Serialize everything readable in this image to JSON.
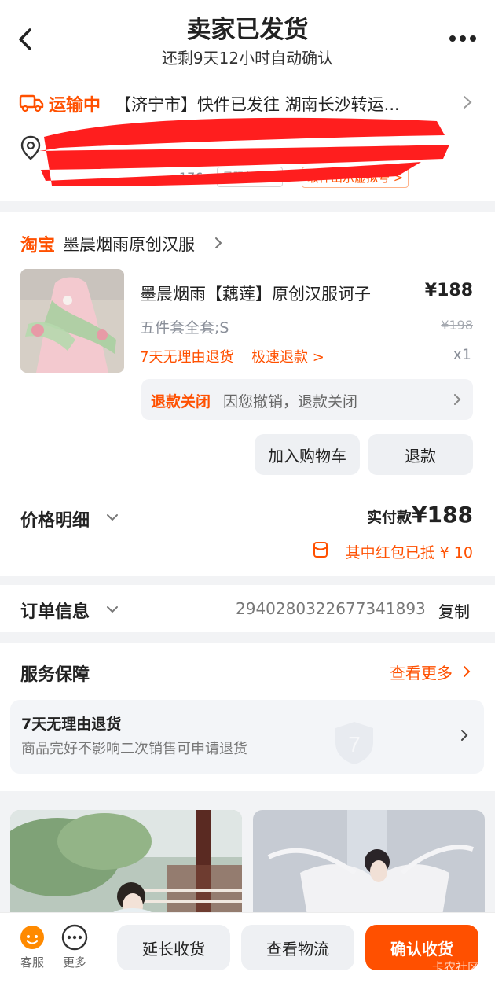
{
  "header": {
    "title": "卖家已发货",
    "subtitle": "还剩9天12小时自动确认"
  },
  "logistics": {
    "status": "运输中",
    "message": "【济宁市】快件已发往 湖南长沙转运...",
    "privacy_tag": "号码保护中",
    "virtual_number_button": "取件出示虚拟号 >",
    "partial_text": "176"
  },
  "shop": {
    "platform": "淘宝",
    "name": "墨晨烟雨原创汉服"
  },
  "product": {
    "title": "墨晨烟雨【藕莲】原创汉服诃子",
    "price": "¥188",
    "spec": "五件套全套;S",
    "original_price": "¥198",
    "return_policy": "7天无理由退货",
    "fast_refund": "极速退款 >",
    "quantity": "x1"
  },
  "refund_notice": {
    "label": "退款关闭",
    "text": "因您撤销，退款关闭"
  },
  "actions": {
    "add_to_cart": "加入购物车",
    "refund": "退款"
  },
  "price_detail": {
    "label": "价格明细",
    "paid_label": "实付款",
    "paid_amount": "¥188",
    "red_packet": "其中红包已抵 ¥ 10"
  },
  "order_info": {
    "label": "订单信息",
    "order_number": "2940280322677341893",
    "copy": "复制"
  },
  "service": {
    "label": "服务保障",
    "more": "查看更多",
    "item_title": "7天无理由退货",
    "item_desc": "商品完好不影响二次销售可申请退货"
  },
  "bottom_bar": {
    "service": "客服",
    "more": "更多",
    "extend": "延长收货",
    "view_logistics": "查看物流",
    "confirm": "确认收货",
    "watermark": "卡农社区"
  },
  "colors": {
    "accent": "#ff5000",
    "background": "#f2f3f5",
    "text": "#222222",
    "secondary_text": "#8a8f99"
  }
}
